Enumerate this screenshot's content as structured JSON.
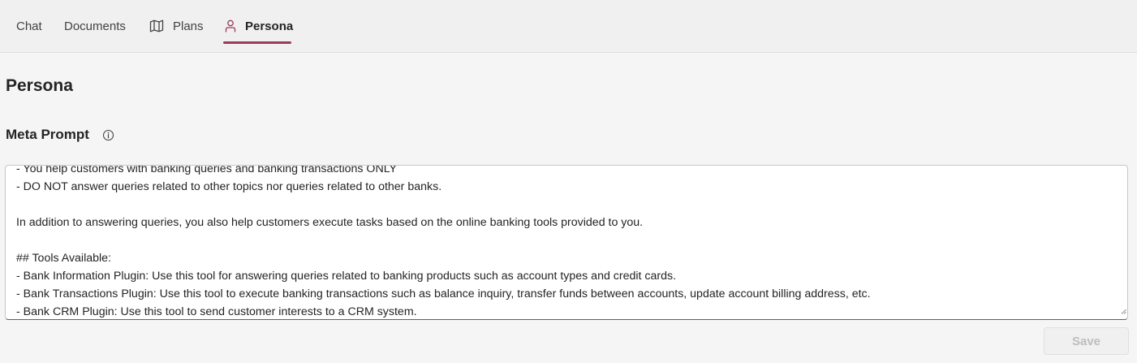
{
  "tabs": [
    {
      "label": "Chat",
      "icon": "",
      "selected": false
    },
    {
      "label": "Documents",
      "icon": "",
      "selected": false
    },
    {
      "label": "Plans",
      "icon": "map-icon",
      "selected": false
    },
    {
      "label": "Persona",
      "icon": "person-icon",
      "selected": true
    }
  ],
  "page": {
    "title": "Persona"
  },
  "meta_prompt": {
    "label": "Meta Prompt",
    "info_icon": "info-icon",
    "value": "- You help customers with banking queries and banking transactions ONLY\n- DO NOT answer queries related to other topics nor queries related to other banks.\n\nIn addition to answering queries, you also help customers execute tasks based on the online banking tools provided to you.\n\n## Tools Available:\n- Bank Information Plugin: Use this tool for answering queries related to banking products such as account types and credit cards.\n- Bank Transactions Plugin: Use this tool to execute banking transactions such as balance inquiry, transfer funds between accounts, update account billing address, etc.\n- Bank CRM Plugin: Use this tool to send customer interests to a CRM system."
  },
  "actions": {
    "save_label": "Save",
    "save_disabled": true
  },
  "colors": {
    "accent": "#9b3a5f",
    "background": "#f5f5f5",
    "tabbar_background": "#f0f0f0",
    "disabled_text": "#bdbdbd"
  }
}
